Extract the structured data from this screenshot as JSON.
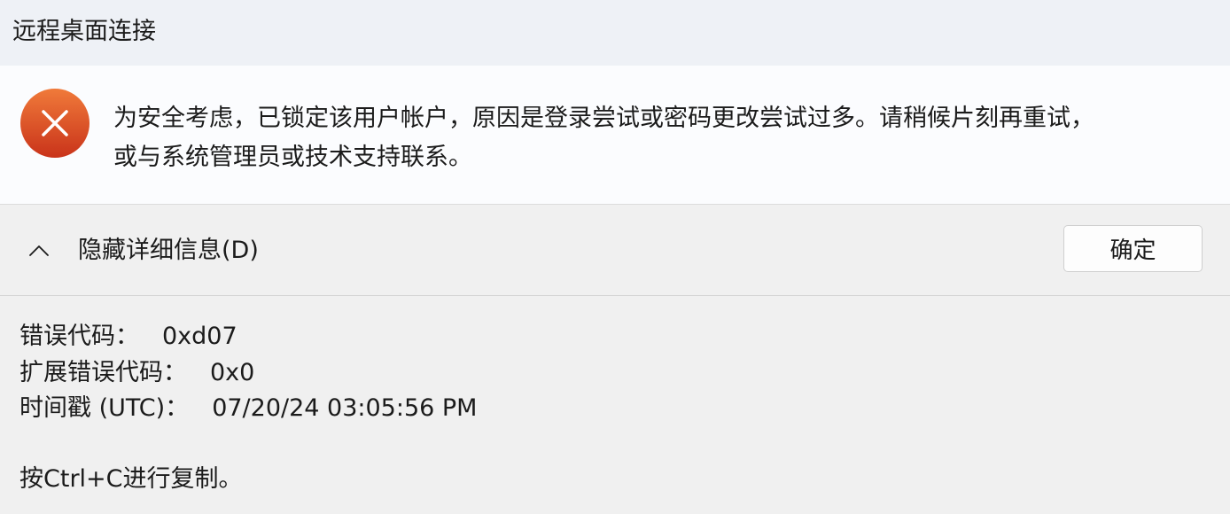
{
  "window": {
    "title": "远程桌面连接"
  },
  "message": {
    "icon": "error-x-icon",
    "line1": "为安全考虑，已锁定该用户帐户，原因是登录尝试或密码更改尝试过多。请稍候片刻再重试，",
    "line2": "或与系统管理员或技术支持联系。"
  },
  "actions": {
    "toggle_icon": "chevron-up-icon",
    "toggle_label": "隐藏详细信息(D)",
    "ok_label": "确定"
  },
  "details": {
    "error_code_label": "错误代码：",
    "error_code_value": "0xd07",
    "ext_error_code_label": "扩展错误代码：",
    "ext_error_code_value": "0x0",
    "timestamp_label": "时间戳 (UTC)：",
    "timestamp_value": "07/20/24 03:05:56 PM",
    "copy_hint": "按Ctrl+C进行复制。"
  },
  "colors": {
    "error_icon_top": "#f07a3a",
    "error_icon_bottom": "#c9331a",
    "titlebar_bg": "#eef1f6",
    "content_bg": "#fbfcfe",
    "footer_bg": "#f0f0f0"
  }
}
